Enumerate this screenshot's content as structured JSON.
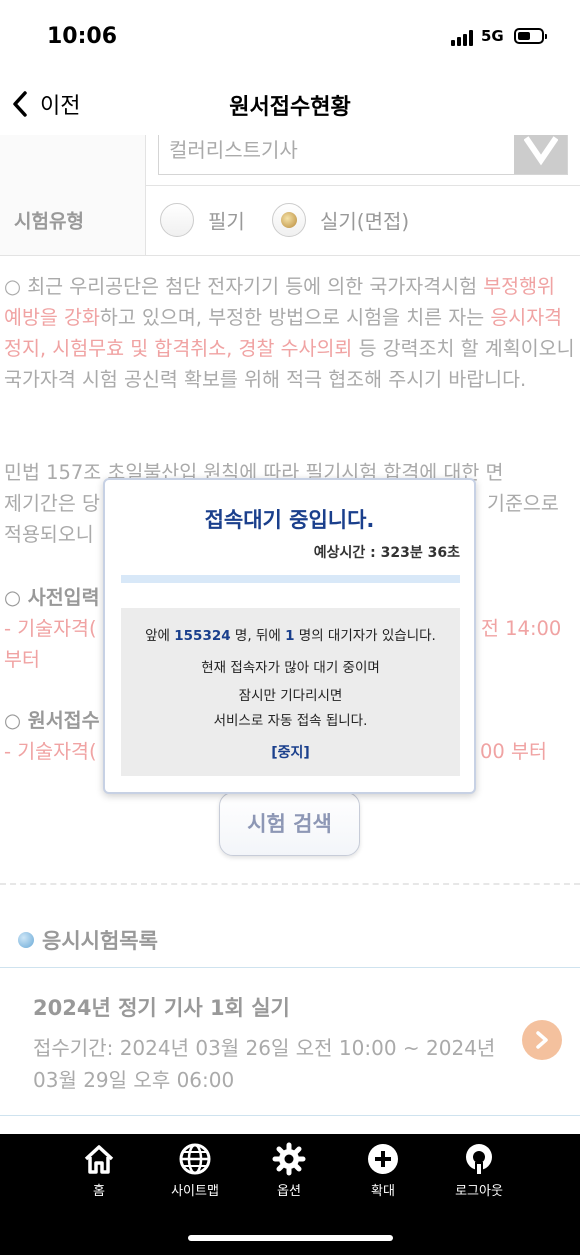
{
  "status": {
    "time": "10:06",
    "network": "5G"
  },
  "nav": {
    "back_label": "이전",
    "title": "원서접수현황"
  },
  "form": {
    "category_value": "컬러리스트기사",
    "exam_type_label": "시험유형",
    "options": [
      {
        "label": "필기",
        "selected": false
      },
      {
        "label": "실기(면접)",
        "selected": true
      }
    ]
  },
  "notice": {
    "p1": [
      "○ 최근 우리공단은 첨단 전자기기 등에 의한 국가자격시험 ",
      "부정행위 예방을 강화",
      "하고 있으며, 부정한 방법으로 시험을 치른 자는 ",
      "응시자격 정지, 시험무효 및 합격취소, 경찰 수사의뢰",
      " 등 강력조치 할 계획이오니 국가자격 시험 공신력 확보를 위해 적극 협조해 주시기 바랍니다."
    ],
    "p2_left": "민법 157조 초일불산입 원칙에 따라 필기시험 합격에 대한 면",
    "p2_line2_left": "제기간은 당",
    "p2_line2_right": "기준으로",
    "p2_line3_left": "적용되오니",
    "s1_title": "○ 사전입력",
    "s1_left": "- 기술자격(",
    "s1_right": "전 14:00",
    "s1_line2": "부터",
    "s2_title": "○ 원서접수",
    "s2_left": "- 기술자격(",
    "s2_right": "00 부터"
  },
  "search_button": "시험 검색",
  "exam_list": {
    "section_title": "응시시험목록",
    "items": [
      {
        "title": "2024년 정기 기사 1회 실기",
        "period": "접수기간: 2024년 03월 26일 오전 10:00 ~ 2024년 03월 29일 오후 06:00"
      }
    ]
  },
  "queue_dialog": {
    "title": "접속대기 중입니다.",
    "eta": "예상시간 : 323분 36초",
    "progress": 0.0,
    "ahead_prefix": "앞에 ",
    "ahead_count": "155324",
    "ahead_mid": " 명, 뒤에 ",
    "behind_count": "1",
    "behind_suffix": " 명의 대기자가 있습니다.",
    "msg1": "현재 접속자가 많아 대기 중이며",
    "msg2": "잠시만 기다리시면",
    "msg3": "서비스로 자동 접속 됩니다.",
    "stop_label": "[중지]"
  },
  "tabbar": [
    {
      "label": "홈",
      "icon": "home-icon"
    },
    {
      "label": "사이트맵",
      "icon": "globe-icon"
    },
    {
      "label": "옵션",
      "icon": "gear-icon"
    },
    {
      "label": "확대",
      "icon": "plus-circle-icon"
    },
    {
      "label": "로그아웃",
      "icon": "logout-icon"
    }
  ]
}
